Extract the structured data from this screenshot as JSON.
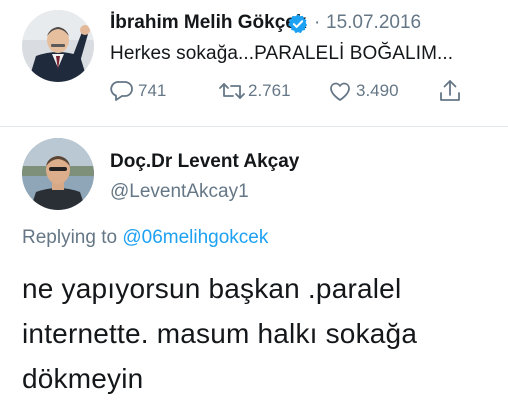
{
  "original_tweet": {
    "author_name": "İbrahim Melih Gökçek",
    "verified_icon": "verified-badge-icon",
    "separator": "·",
    "date": "15.07.2016",
    "text": "Herkes sokağa...PARALELİ BOĞALIM...",
    "actions": {
      "reply_count": "741",
      "retweet_count": "2.761",
      "like_count": "3.490"
    },
    "colors": {
      "verified": "#1da1f2",
      "muted": "#657786"
    }
  },
  "reply_tweet": {
    "author_name": "Doç.Dr Levent Akçay",
    "handle": "@LeventAkcay1",
    "replying_prefix": "Replying to",
    "replying_to": "@06melihgokcek",
    "body_lines": [
      "ne yapıyorsun başkan .paralel",
      "internette. masum halkı sokağa",
      "dökmeyin"
    ],
    "colors": {
      "mention": "#1da1f2"
    }
  }
}
